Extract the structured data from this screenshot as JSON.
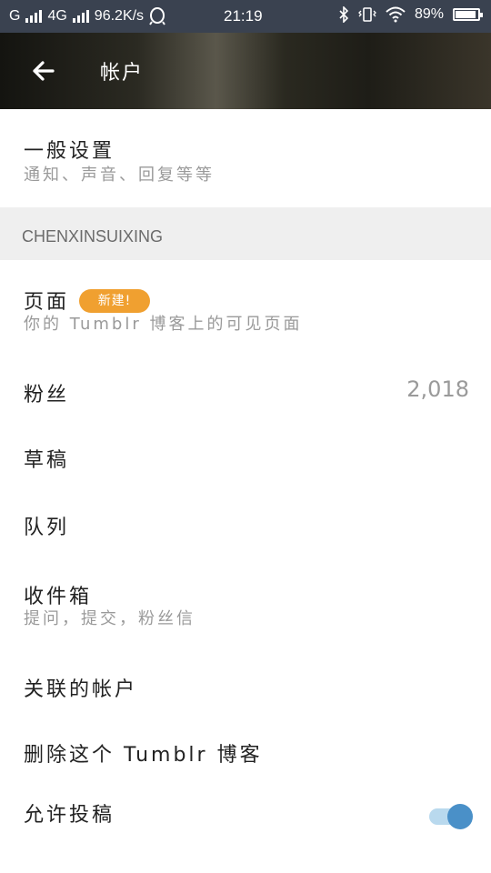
{
  "status_bar": {
    "carrier1": "G",
    "carrier2": "4G",
    "net_speed": "96.2K/s",
    "time": "21:19",
    "battery": "89%"
  },
  "header": {
    "title": "帐户"
  },
  "items": {
    "general_settings": {
      "title": "一般设置",
      "subtitle": "通知、声音、回复等等"
    },
    "section_account": "CHENXINSUIXING",
    "pages": {
      "title": "页面",
      "badge": "新建!",
      "subtitle": "你的 Tumblr 博客上的可见页面"
    },
    "followers": {
      "title": "粉丝",
      "count": "2,018"
    },
    "drafts": {
      "title": "草稿"
    },
    "queue": {
      "title": "队列"
    },
    "inbox": {
      "title": "收件箱",
      "subtitle": "提问，提交，粉丝信"
    },
    "linked_accounts": {
      "title": "关联的帐户"
    },
    "delete_blog": {
      "title": "删除这个 Tumblr 博客"
    },
    "allow_submissions": {
      "title": "允许投稿",
      "enabled": true
    }
  }
}
